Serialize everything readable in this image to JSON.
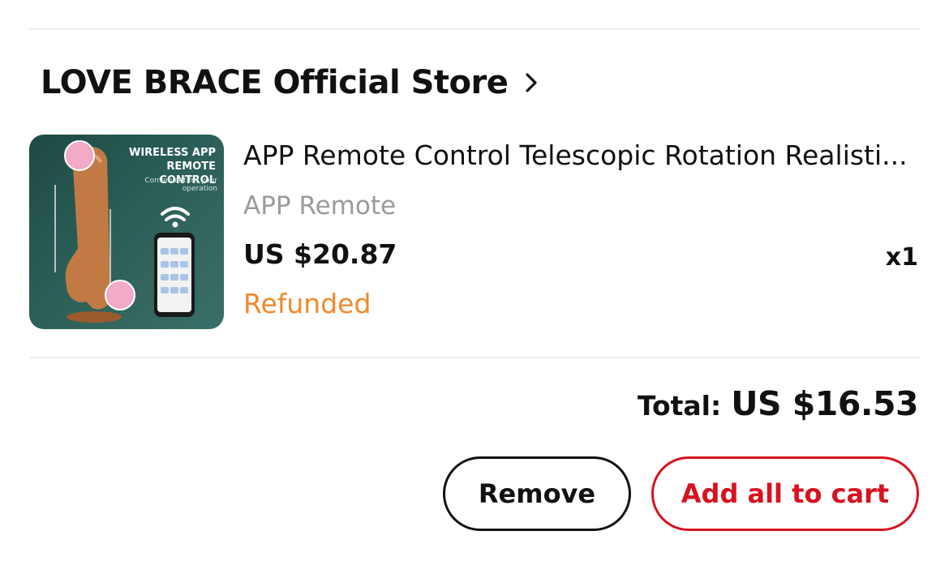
{
  "store": {
    "name": "LOVE BRACE Official Store"
  },
  "product": {
    "title": "APP Remote Control Telescopic Rotation Realisti...",
    "variant": "APP Remote",
    "price": "US $20.87",
    "quantity": "x1",
    "status": "Refunded",
    "image_text": {
      "headline_line1": "WIRELESS APP",
      "headline_line2": "REMOTE CONTROL",
      "subline": "Convenient for your operation"
    }
  },
  "order": {
    "total_label": "Total:",
    "total_value": "US $16.53"
  },
  "actions": {
    "remove_label": "Remove",
    "add_all_label": "Add all to cart"
  },
  "colors": {
    "accent_red": "#d8121e",
    "status_orange": "#f08a2a",
    "variant_gray": "#9b9b9b"
  }
}
